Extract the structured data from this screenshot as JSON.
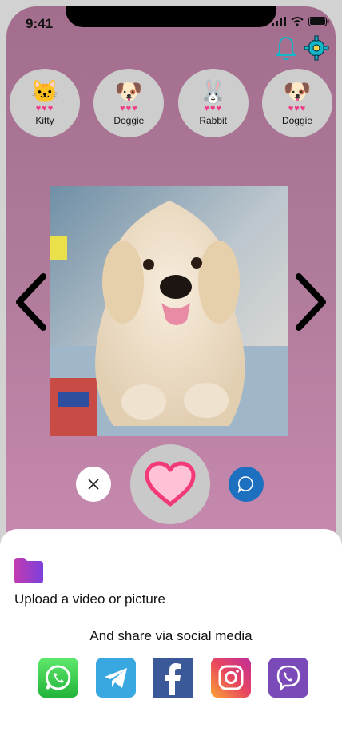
{
  "status_bar": {
    "time": "9:41"
  },
  "stories": [
    {
      "name": "Kitty",
      "emoji": "🐱",
      "hearts": "♥♥♥",
      "icon": "cat-icon"
    },
    {
      "name": "Doggie",
      "emoji": "🐶",
      "hearts": "♥♥♥",
      "icon": "dog-icon"
    },
    {
      "name": "Rabbit",
      "emoji": "🐰",
      "hearts": "♥♥♥",
      "icon": "rabbit-icon"
    },
    {
      "name": "Doggie",
      "emoji": "🐶",
      "hearts": "♥♥♥",
      "icon": "dog-icon"
    }
  ],
  "sheet": {
    "upload_label": "Upload a video or picture",
    "share_label": "And share via social media"
  },
  "social": [
    "whatsapp-icon",
    "telegram-icon",
    "facebook-icon",
    "instagram-icon",
    "viber-icon"
  ],
  "colors": {
    "background_top": "#a36e8e",
    "background_bottom": "#cf90b5",
    "heart": "#f23a78",
    "chat": "#1d6fc0",
    "teal": "#14b6c8"
  }
}
